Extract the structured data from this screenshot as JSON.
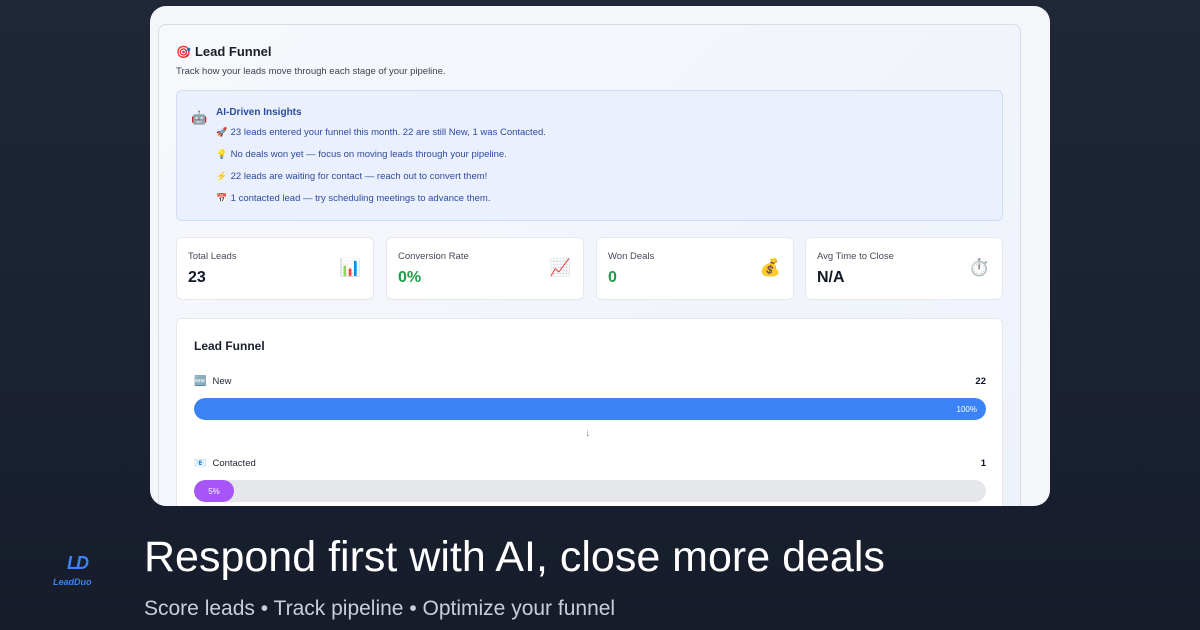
{
  "panel": {
    "title_icon": "🎯",
    "title": "Lead Funnel",
    "subtitle": "Track how your leads move through each stage of your pipeline."
  },
  "insights": {
    "icon": "🤖",
    "title": "AI-Driven Insights",
    "items": [
      {
        "icon": "🚀",
        "text": "23 leads entered your funnel this month. 22 are still New, 1 was Contacted."
      },
      {
        "icon": "💡",
        "text": "No deals won yet — focus on moving leads through your pipeline."
      },
      {
        "icon": "⚡",
        "text": "22 leads are waiting for contact — reach out to convert them!"
      },
      {
        "icon": "📅",
        "text": "1 contacted lead — try scheduling meetings to advance them."
      }
    ]
  },
  "stats": [
    {
      "label": "Total Leads",
      "value": "23",
      "icon": "📊"
    },
    {
      "label": "Conversion Rate",
      "value": "0%",
      "icon": "📈"
    },
    {
      "label": "Won Deals",
      "value": "0",
      "icon": "💰"
    },
    {
      "label": "Avg Time to Close",
      "value": "N/A",
      "icon": "⏱️"
    }
  ],
  "funnel": {
    "title": "Lead Funnel",
    "arrow": "↓",
    "stages": [
      {
        "icon": "🆕",
        "label": "New",
        "count": "22",
        "percent_label": "100%",
        "fraction": 1.0,
        "color": "#3b82f6"
      },
      {
        "icon": "📧",
        "label": "Contacted",
        "count": "1",
        "percent_label": "5%",
        "fraction": 0.05,
        "color": "#a855f7"
      }
    ]
  },
  "brand": {
    "logo_mark": "LD",
    "logo_text": "LeadDuo",
    "headline": "Respond first with AI, close more deals",
    "tagline": "Score leads • Track pipeline • Optimize your funnel"
  }
}
